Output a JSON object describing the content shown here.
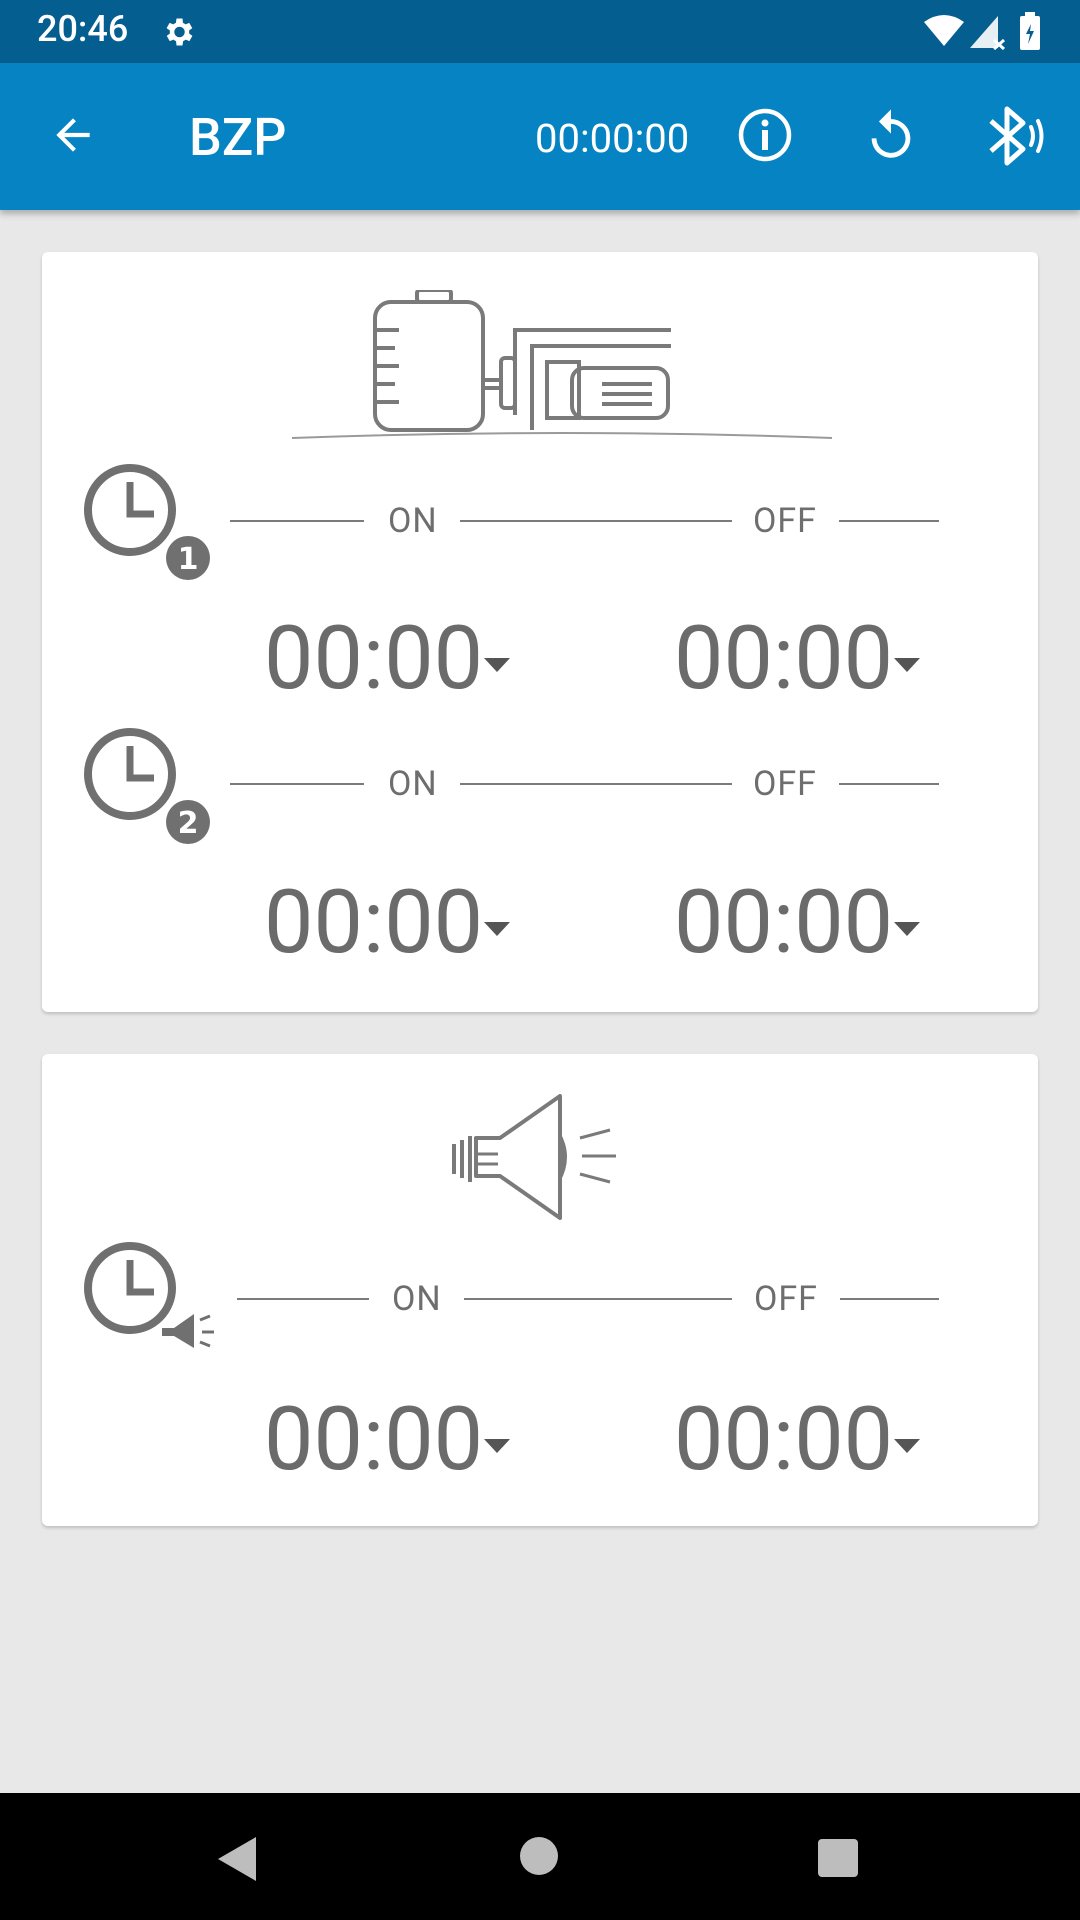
{
  "status_bar": {
    "time": "20:46",
    "icons": [
      "settings-icon",
      "wifi-icon",
      "cellular-icon",
      "battery-icon"
    ]
  },
  "app_bar": {
    "title": "BZP",
    "timer": "00:00:00",
    "icons": [
      "back-arrow-icon",
      "info-icon",
      "refresh-icon",
      "bluetooth-icon"
    ]
  },
  "pump_card": {
    "illustration": "pump-icon",
    "timers": [
      {
        "badge": "1",
        "on_label": "ON",
        "off_label": "OFF",
        "on_time": "00:00",
        "off_time": "00:00"
      },
      {
        "badge": "2",
        "on_label": "ON",
        "off_label": "OFF",
        "on_time": "00:00",
        "off_time": "00:00"
      }
    ]
  },
  "alarm_card": {
    "illustration": "speaker-icon",
    "timer": {
      "on_label": "ON",
      "off_label": "OFF",
      "on_time": "00:00",
      "off_time": "00:00"
    }
  },
  "nav_bar": {
    "buttons": [
      "back-nav-icon",
      "home-nav-icon",
      "recents-nav-icon"
    ]
  },
  "colors": {
    "status_bar": "#045e8f",
    "app_bar": "#0583c2",
    "background": "#e8e8e8",
    "card": "#ffffff",
    "icon_gray": "#7a7a7a"
  }
}
